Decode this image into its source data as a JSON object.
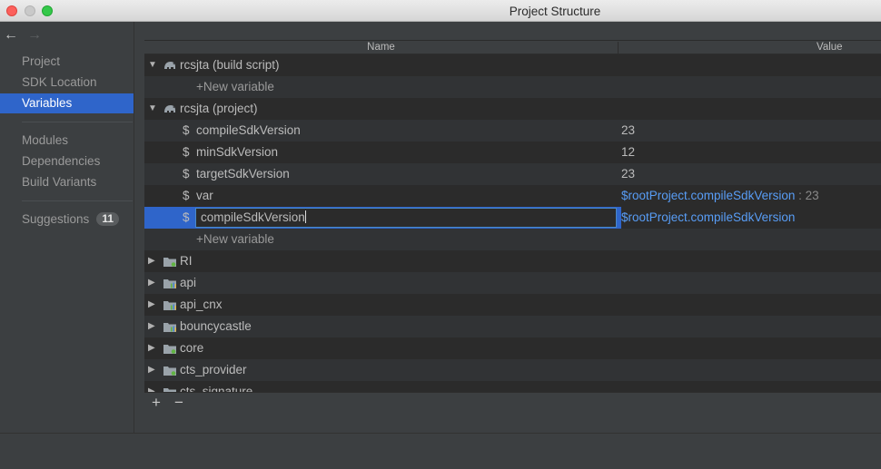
{
  "window": {
    "title": "Project Structure"
  },
  "nav": {
    "back": "←",
    "forward": "→"
  },
  "sidebar": {
    "items": [
      {
        "label": "Project"
      },
      {
        "label": "SDK Location"
      },
      {
        "label": "Variables",
        "active": true
      },
      {
        "label": "Modules"
      },
      {
        "label": "Dependencies"
      },
      {
        "label": "Build Variants"
      },
      {
        "label": "Suggestions",
        "badge": "11"
      }
    ]
  },
  "table": {
    "headers": {
      "name": "Name",
      "value": "Value"
    },
    "groups": [
      {
        "label": "rcsjta (build script)"
      },
      {
        "label": "rcsjta (project)"
      }
    ],
    "new_variable_label": "+New variable",
    "variables": [
      {
        "name": "compileSdkVersion",
        "value": "23"
      },
      {
        "name": "minSdkVersion",
        "value": "12"
      },
      {
        "name": "targetSdkVersion",
        "value": "23"
      },
      {
        "name": "var",
        "value_ref": "$rootProject.compileSdkVersion",
        "value_resolved": " : 23"
      }
    ],
    "editing": {
      "name": "compileSdkVersion",
      "value_ref": "$rootProject.compileSdkVersion"
    },
    "modules": [
      {
        "label": "RI"
      },
      {
        "label": "api"
      },
      {
        "label": "api_cnx"
      },
      {
        "label": "bouncycastle"
      },
      {
        "label": "core"
      },
      {
        "label": "cts_provider"
      },
      {
        "label": "cts_signature"
      }
    ]
  },
  "toolbar": {
    "add": "+",
    "remove": "−"
  },
  "colors": {
    "accent": "#2f65ca",
    "link": "#589df6",
    "background": "#2b2b2b",
    "panel": "#3c3f41"
  }
}
